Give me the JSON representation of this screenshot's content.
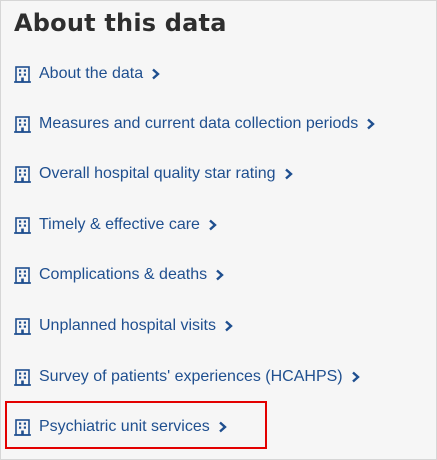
{
  "panel": {
    "title": "About this data",
    "items": [
      {
        "label": "About the data",
        "icon": "building-icon",
        "chevron": "chevron-right-icon"
      },
      {
        "label": "Measures and current data collection periods",
        "icon": "building-icon",
        "chevron": "chevron-right-icon"
      },
      {
        "label": "Overall hospital quality star rating",
        "icon": "building-icon",
        "chevron": "chevron-right-icon"
      },
      {
        "label": "Timely & effective care",
        "icon": "building-icon",
        "chevron": "chevron-right-icon"
      },
      {
        "label": "Complications & deaths",
        "icon": "building-icon",
        "chevron": "chevron-right-icon"
      },
      {
        "label": "Unplanned hospital visits",
        "icon": "building-icon",
        "chevron": "chevron-right-icon"
      },
      {
        "label": "Survey of patients' experiences (HCAHPS)",
        "icon": "building-icon",
        "chevron": "chevron-right-icon"
      },
      {
        "label": "Psychiatric unit services",
        "icon": "building-icon",
        "chevron": "chevron-right-icon",
        "highlighted": true
      }
    ]
  },
  "colors": {
    "link": "#1f4f8f",
    "title": "#2e2e2e",
    "background": "#f6f6f6",
    "highlight_border": "#e30000"
  }
}
